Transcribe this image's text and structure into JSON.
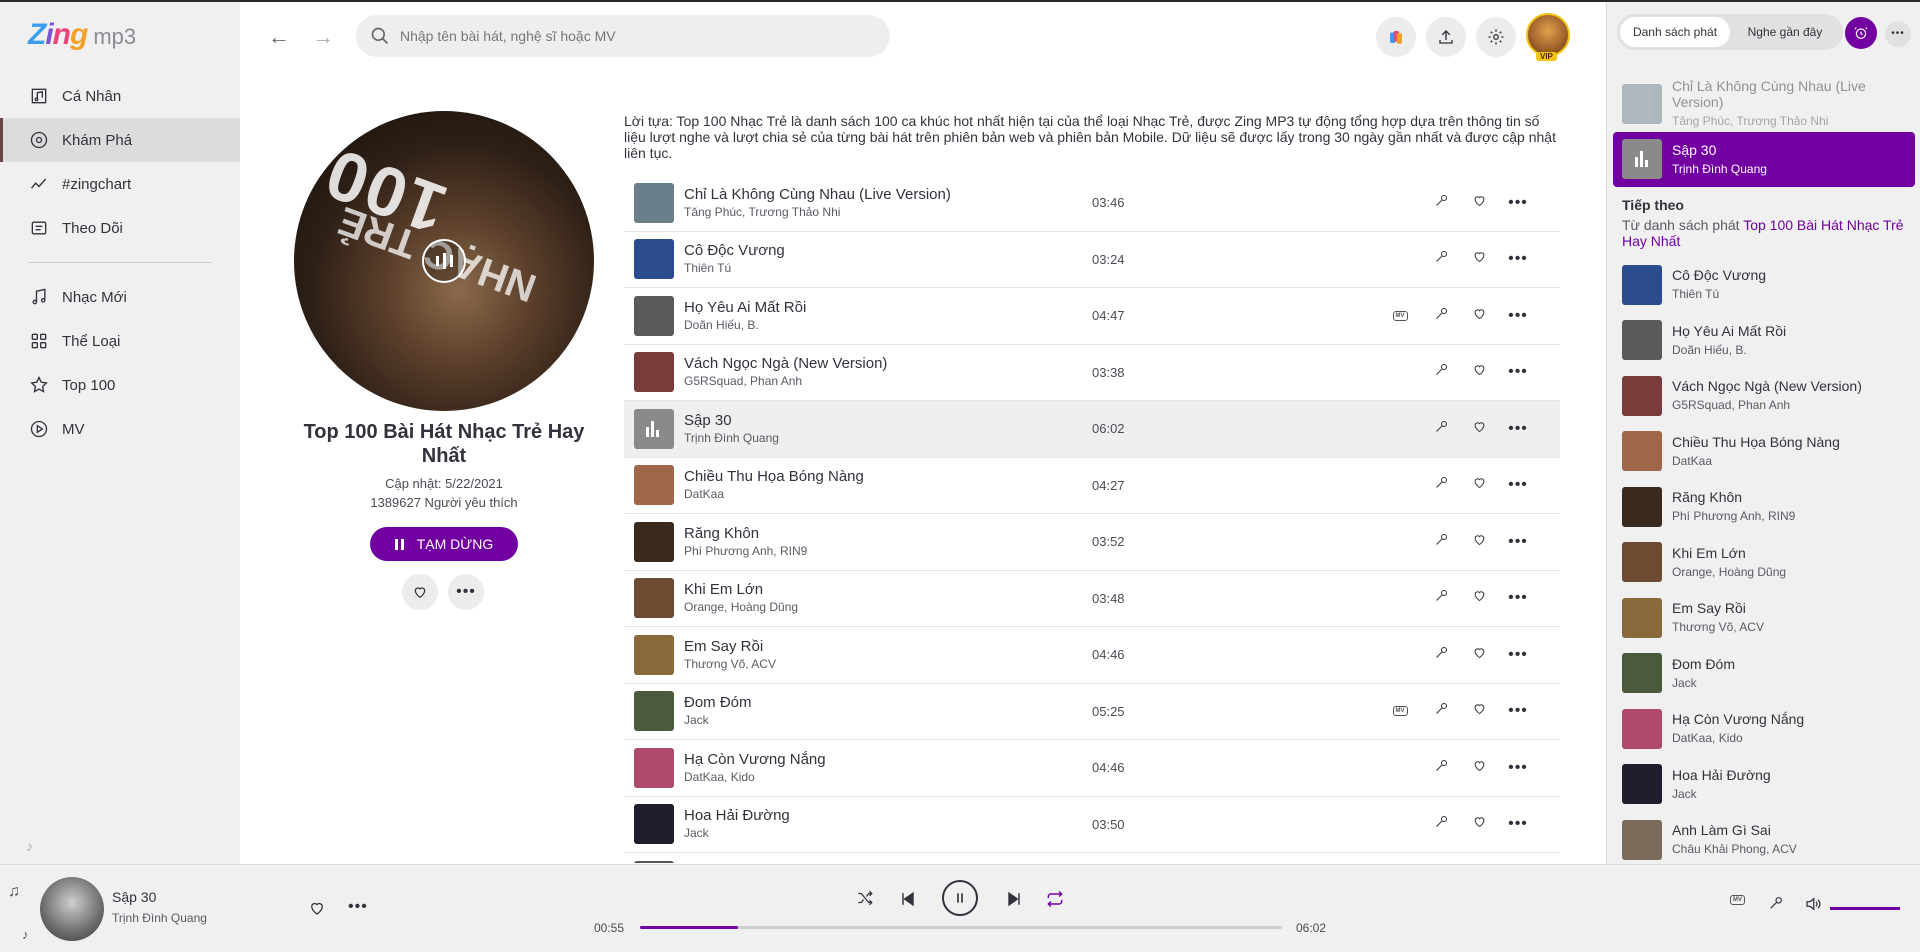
{
  "brand": {
    "logo_main": "Zing",
    "logo_sub": "mp3"
  },
  "sidebar": {
    "items": [
      {
        "label": "Cá Nhân",
        "icon": "music-library-icon"
      },
      {
        "label": "Khám Phá",
        "icon": "disc-icon"
      },
      {
        "label": "#zingchart",
        "icon": "chart-line-icon"
      },
      {
        "label": "Theo Dõi",
        "icon": "newspaper-icon"
      }
    ],
    "items2": [
      {
        "label": "Nhạc Mới",
        "icon": "music-note-icon"
      },
      {
        "label": "Thể Loại",
        "icon": "category-icon"
      },
      {
        "label": "Top 100",
        "icon": "star-icon"
      },
      {
        "label": "MV",
        "icon": "play-circle-icon"
      }
    ]
  },
  "header": {
    "search_placeholder": "Nhập tên bài hát, nghệ sĩ hoặc MV",
    "vip_badge": "VIP"
  },
  "playlist": {
    "title": "Top 100 Bài Hát Nhạc Trẻ Hay Nhất",
    "updated": "Cập nhật: 5/22/2021",
    "likes": "1389627 Người yêu thích",
    "pause_label": "TẠM DỪNG",
    "description": "Lời tựa: Top 100 Nhạc Trẻ là danh sách 100 ca khúc hot nhất hiện tại của thể loại Nhạc Trẻ, được Zing MP3 tự động tổng hợp dựa trên thông tin số liệu lượt nghe và lượt chia sẻ của từng bài hát trên phiên bản web và phiên bản Mobile. Dữ liệu sẽ được lấy trong 30 ngày gần nhất và được cập nhật liên tục.",
    "cover_text": "100",
    "cover_text2": "NHẠC TRẺ"
  },
  "songs": [
    {
      "name": "Chỉ Là Không Cùng Nhau (Live Version)",
      "artist": "Tăng Phúc, Trương Thảo Nhi",
      "duration": "03:46",
      "mv": false,
      "color": "#6b7f8a"
    },
    {
      "name": "Cô Độc Vương",
      "artist": "Thiên Tú",
      "duration": "03:24",
      "mv": false,
      "color": "#2a4c8f"
    },
    {
      "name": "Họ Yêu Ai Mất Rồi",
      "artist": "Doãn Hiếu, B.",
      "duration": "04:47",
      "mv": true,
      "color": "#5a5a5a"
    },
    {
      "name": "Vách Ngọc Ngà (New Version)",
      "artist": "G5RSquad, Phan Anh",
      "duration": "03:38",
      "mv": false,
      "color": "#7a3b3b"
    },
    {
      "name": "Sập 30",
      "artist": "Trịnh Đình Quang",
      "duration": "06:02",
      "mv": false,
      "color": "#8a8a8a",
      "playing": true
    },
    {
      "name": "Chiều Thu Họa Bóng Nàng",
      "artist": "DatKaa",
      "duration": "04:27",
      "mv": false,
      "color": "#a0664a"
    },
    {
      "name": "Răng Khôn",
      "artist": "Phí Phương Anh, RIN9",
      "duration": "03:52",
      "mv": false,
      "color": "#3a2a1e"
    },
    {
      "name": "Khi Em Lớn",
      "artist": "Orange, Hoàng Dũng",
      "duration": "03:48",
      "mv": false,
      "color": "#6e4a32"
    },
    {
      "name": "Em Say Rồi",
      "artist": "Thương Võ, ACV",
      "duration": "04:46",
      "mv": false,
      "color": "#8a6a3a"
    },
    {
      "name": "Đom Đóm",
      "artist": "Jack",
      "duration": "05:25",
      "mv": true,
      "color": "#4a5a3a"
    },
    {
      "name": "Hạ Còn Vương Nắng",
      "artist": "DatKaa, Kido",
      "duration": "04:46",
      "mv": false,
      "color": "#b04a6a"
    },
    {
      "name": "Hoa Hải Đường",
      "artist": "Jack",
      "duration": "03:50",
      "mv": false,
      "color": "#1e1e2e"
    },
    {
      "name": "",
      "artist": "",
      "duration": "",
      "mv": false,
      "color": "#555555"
    }
  ],
  "right_panel": {
    "tabs": [
      "Danh sách phát",
      "Nghe gần đây"
    ],
    "previous": {
      "name": "Chỉ Là Không Cùng Nhau (Live Version)",
      "artist": "Tăng Phúc, Trương Thảo Nhi"
    },
    "current": {
      "name": "Sập 30",
      "artist": "Trịnh Đình Quang"
    },
    "next_title": "Tiếp theo",
    "next_from": "Từ danh sách phát",
    "next_playlist": "Top 100 Bài Hát Nhạc Trẻ Hay Nhất",
    "queue": [
      {
        "name": "Cô Độc Vương",
        "artist": "Thiên Tú",
        "color": "#2a4c8f"
      },
      {
        "name": "Họ Yêu Ai Mất Rồi",
        "artist": "Doãn Hiếu, B.",
        "color": "#5a5a5a"
      },
      {
        "name": "Vách Ngọc Ngà (New Version)",
        "artist": "G5RSquad, Phan Anh",
        "color": "#7a3b3b"
      },
      {
        "name": "Chiều Thu Họa Bóng Nàng",
        "artist": "DatKaa",
        "color": "#a0664a"
      },
      {
        "name": "Răng Khôn",
        "artist": "Phí Phương Anh, RIN9",
        "color": "#3a2a1e"
      },
      {
        "name": "Khi Em Lớn",
        "artist": "Orange, Hoàng Dũng",
        "color": "#6e4a32"
      },
      {
        "name": "Em Say Rồi",
        "artist": "Thương Võ, ACV",
        "color": "#8a6a3a"
      },
      {
        "name": "Đom Đóm",
        "artist": "Jack",
        "color": "#4a5a3a"
      },
      {
        "name": "Hạ Còn Vương Nắng",
        "artist": "DatKaa, Kido",
        "color": "#b04a6a"
      },
      {
        "name": "Hoa Hải Đường",
        "artist": "Jack",
        "color": "#1e1e2e"
      },
      {
        "name": "Anh Làm Gì Sai",
        "artist": "Châu Khải Phong, ACV",
        "color": "#7a6a5a"
      }
    ]
  },
  "player": {
    "song": "Sập 30",
    "artist": "Trịnh Đình Quang",
    "current_time": "00:55",
    "total_time": "06:02",
    "progress": 0.152,
    "volume": 1.0
  },
  "colors": {
    "accent": "#7200a1",
    "sidebar_bg": "#f0f0f0"
  }
}
